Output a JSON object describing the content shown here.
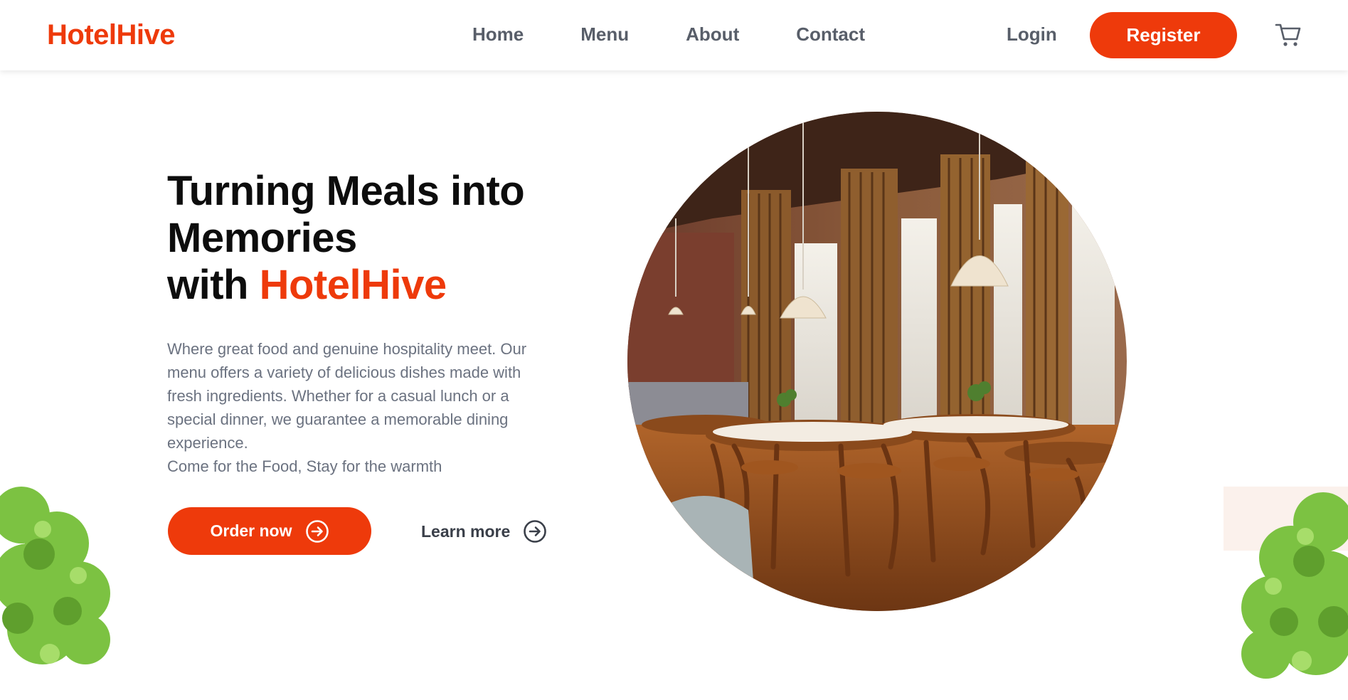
{
  "brand": {
    "name": "HotelHive",
    "accent_color": "#ee3a0b"
  },
  "nav": {
    "links": [
      {
        "label": "Home"
      },
      {
        "label": "Menu"
      },
      {
        "label": "About"
      },
      {
        "label": "Contact"
      }
    ],
    "login_label": "Login",
    "register_label": "Register",
    "cart_icon": "shopping-cart-icon"
  },
  "hero": {
    "title_line1": "Turning Meals into",
    "title_line2": "Memories",
    "title_line3_prefix": "with",
    "title_line3_accent": "HotelHive",
    "description": "Where great food and genuine hospitality meet. Our menu offers a variety of delicious dishes made with fresh ingredients. Whether for a casual lunch or a special dinner, we guarantee a memorable dining experience.",
    "tagline": "Come for the Food, Stay for the warmth",
    "order_button": "Order now",
    "learn_more": "Learn more",
    "arrow_icon": "arrow-circle-right-icon",
    "image": "restaurant-interior-photo",
    "decor": "lettuce-leaves"
  },
  "colors": {
    "accent": "#ee3a0b",
    "nav_text": "#585e69",
    "body_text": "#6b7280",
    "heading": "#0d0d0d"
  }
}
